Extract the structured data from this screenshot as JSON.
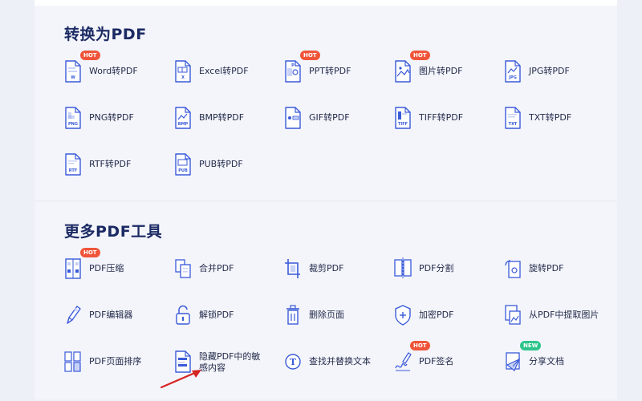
{
  "sections": [
    {
      "title": "转换为PDF",
      "tools": [
        {
          "label": "Word转PDF",
          "badge": "HOT",
          "icon": "word-file-icon"
        },
        {
          "label": "Excel转PDF",
          "badge": "",
          "icon": "excel-file-icon"
        },
        {
          "label": "PPT转PDF",
          "badge": "HOT",
          "icon": "ppt-file-icon"
        },
        {
          "label": "图片转PDF",
          "badge": "HOT",
          "icon": "image-file-icon"
        },
        {
          "label": "JPG转PDF",
          "badge": "",
          "icon": "jpg-file-icon"
        },
        {
          "label": "PNG转PDF",
          "badge": "",
          "icon": "png-file-icon"
        },
        {
          "label": "BMP转PDF",
          "badge": "",
          "icon": "bmp-file-icon"
        },
        {
          "label": "GIF转PDF",
          "badge": "",
          "icon": "gif-file-icon"
        },
        {
          "label": "TIFF转PDF",
          "badge": "",
          "icon": "tiff-file-icon"
        },
        {
          "label": "TXT转PDF",
          "badge": "",
          "icon": "txt-file-icon"
        },
        {
          "label": "RTF转PDF",
          "badge": "",
          "icon": "rtf-file-icon"
        },
        {
          "label": "PUB转PDF",
          "badge": "",
          "icon": "pub-file-icon"
        }
      ]
    },
    {
      "title": "更多PDF工具",
      "tools": [
        {
          "label": "PDF压缩",
          "badge": "HOT",
          "icon": "compress-icon"
        },
        {
          "label": "合并PDF",
          "badge": "",
          "icon": "merge-icon"
        },
        {
          "label": "裁剪PDF",
          "badge": "",
          "icon": "crop-icon"
        },
        {
          "label": "PDF分割",
          "badge": "",
          "icon": "split-icon"
        },
        {
          "label": "旋转PDF",
          "badge": "",
          "icon": "rotate-icon"
        },
        {
          "label": "PDF编辑器",
          "badge": "",
          "icon": "edit-pen-icon"
        },
        {
          "label": "解锁PDF",
          "badge": "",
          "icon": "unlock-icon"
        },
        {
          "label": "删除页面",
          "badge": "",
          "icon": "trash-icon"
        },
        {
          "label": "加密PDF",
          "badge": "",
          "icon": "shield-plus-icon"
        },
        {
          "label": "从PDF中提取图片",
          "badge": "",
          "icon": "extract-image-icon"
        },
        {
          "label": "PDF页面排序",
          "badge": "",
          "icon": "reorder-pages-icon"
        },
        {
          "label": "隐藏PDF中的敏感内容",
          "badge": "",
          "icon": "redact-icon"
        },
        {
          "label": "查找并替换文本",
          "badge": "",
          "icon": "find-replace-text-icon"
        },
        {
          "label": "PDF签名",
          "badge": "HOT",
          "icon": "signature-icon"
        },
        {
          "label": "分享文档",
          "badge": "NEW",
          "icon": "share-document-icon"
        }
      ]
    }
  ],
  "colors": {
    "accent": "#3a5ad9",
    "hot": "#f0553a",
    "new": "#2fc48b",
    "arrow": "#d62424"
  }
}
